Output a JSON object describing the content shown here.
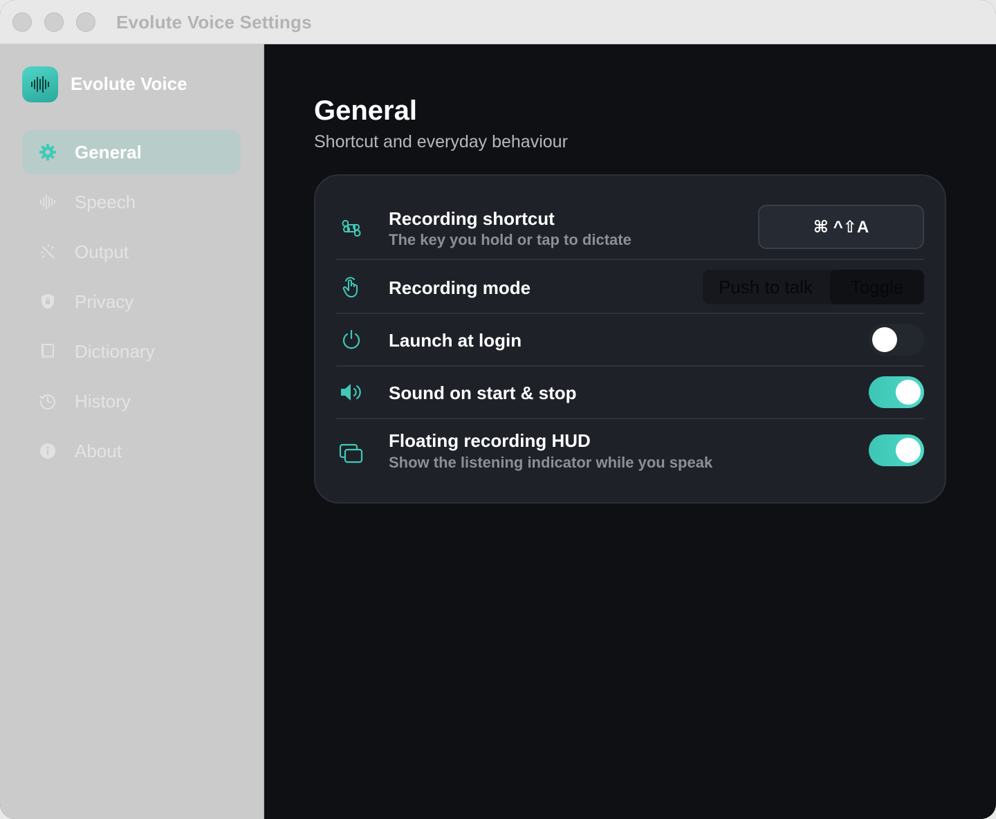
{
  "window": {
    "title": "Evolute Voice Settings"
  },
  "sidebar": {
    "brand": {
      "name": "Evolute Voice",
      "icon": "waveform-icon"
    },
    "items": [
      {
        "label": "General",
        "icon": "gear-icon",
        "active": true
      },
      {
        "label": "Speech",
        "icon": "waveform-icon",
        "active": false
      },
      {
        "label": "Output",
        "icon": "magic-wand-icon",
        "active": false
      },
      {
        "label": "Privacy",
        "icon": "shield-icon",
        "active": false
      },
      {
        "label": "Dictionary",
        "icon": "book-icon",
        "active": false
      },
      {
        "label": "History",
        "icon": "clock-history-icon",
        "active": false
      },
      {
        "label": "About",
        "icon": "info-icon",
        "active": false
      }
    ]
  },
  "main": {
    "title": "General",
    "subtitle": "Shortcut and everyday behaviour",
    "settings": {
      "shortcut": {
        "title": "Recording shortcut",
        "description": "The key you hold or tap to dictate",
        "value": "⌘ ^⇧A",
        "icon": "command-icon"
      },
      "mode": {
        "title": "Recording mode",
        "options": [
          "Push to talk",
          "Toggle"
        ],
        "selected": "Toggle",
        "icon": "hand-tap-icon"
      },
      "launch": {
        "title": "Launch at login",
        "enabled": false,
        "icon": "power-icon"
      },
      "sound": {
        "title": "Sound on start & stop",
        "enabled": true,
        "icon": "speaker-icon"
      },
      "hud": {
        "title": "Floating recording HUD",
        "description": "Show the listening indicator while you speak",
        "enabled": true,
        "icon": "windows-stack-icon"
      }
    }
  },
  "colors": {
    "accent": "#3fcab8",
    "sidebar_bg": "#cbcbcb",
    "main_bg": "#0e1014",
    "card_bg": "#1e2128"
  }
}
